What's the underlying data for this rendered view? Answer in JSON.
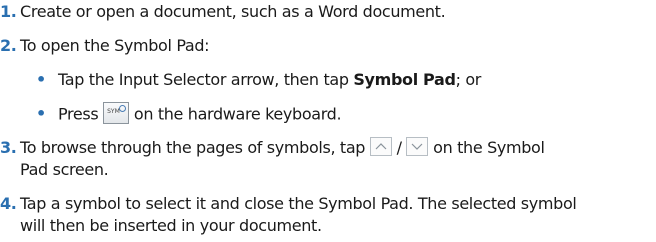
{
  "steps": [
    {
      "number": "1.",
      "text": "Create or open a document, such as a Word document."
    },
    {
      "number": "2.",
      "text": "To open the Symbol Pad:"
    },
    {
      "number": "3.",
      "text_before": "To browse through the pages of symbols, tap",
      "separator": "/",
      "text_after": "on the Symbol",
      "continuation": "Pad screen."
    },
    {
      "number": "4.",
      "line1": "Tap a symbol to select it and close the Symbol Pad. The selected symbol",
      "line2": "will then be inserted in your document."
    }
  ],
  "substeps": [
    {
      "bullet": "•",
      "text_before": "Tap the Input Selector arrow, then tap ",
      "bold": "Symbol Pad",
      "text_after": "; or"
    },
    {
      "bullet": "•",
      "text_before": "Press",
      "text_after": "on the hardware keyboard."
    }
  ],
  "icons": {
    "sym_key": {
      "name": "sym-key-icon",
      "label": "SYM"
    },
    "page_up": {
      "name": "page-up-arrow-icon"
    },
    "page_down": {
      "name": "page-down-arrow-icon"
    }
  }
}
